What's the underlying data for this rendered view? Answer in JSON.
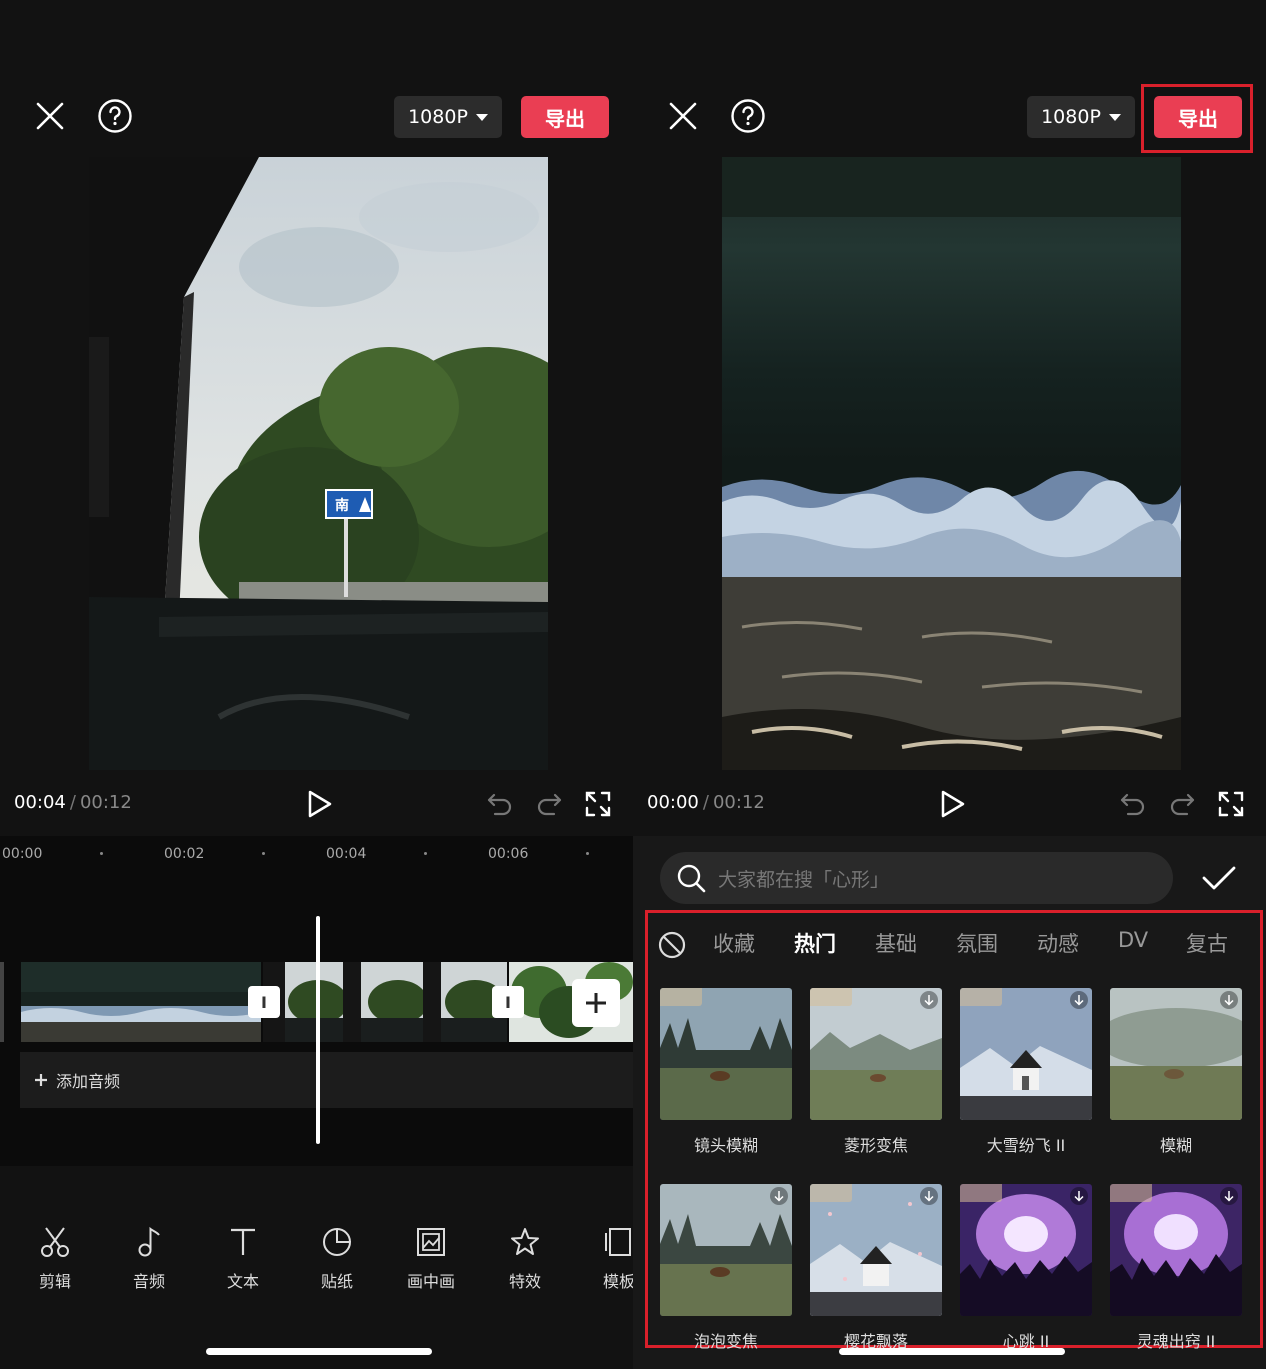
{
  "left": {
    "resolution": "1080P",
    "export_label": "导出",
    "time_current": "00:04",
    "time_sep": "/",
    "time_total": "00:12",
    "ruler": [
      "00:00",
      "00:02",
      "00:04",
      "00:06"
    ],
    "clip_separator": "I",
    "add_audio": "添加音频",
    "tools": [
      {
        "label": "剪辑",
        "icon": "scissors-icon"
      },
      {
        "label": "音频",
        "icon": "music-note-icon"
      },
      {
        "label": "文本",
        "icon": "text-icon"
      },
      {
        "label": "贴纸",
        "icon": "sticker-icon"
      },
      {
        "label": "画中画",
        "icon": "picture-in-picture-icon"
      },
      {
        "label": "特效",
        "icon": "effects-star-icon"
      },
      {
        "label": "模板",
        "icon": "template-icon"
      }
    ],
    "preview_sign": "南"
  },
  "right": {
    "resolution": "1080P",
    "export_label": "导出",
    "time_current": "00:00",
    "time_sep": "/",
    "time_total": "00:12",
    "search_placeholder": "大家都在搜「心形」",
    "categories": [
      "收藏",
      "热门",
      "基础",
      "氛围",
      "动感",
      "DV",
      "复古"
    ],
    "active_category": "热门",
    "effects": [
      {
        "name": "镜头模糊"
      },
      {
        "name": "菱形变焦"
      },
      {
        "name": "大雪纷飞 II"
      },
      {
        "name": "模糊"
      },
      {
        "name": "泡泡变焦"
      },
      {
        "name": "樱花飘落"
      },
      {
        "name": "心跳 II"
      },
      {
        "name": "灵魂出窍 II"
      }
    ]
  },
  "colors": {
    "export": "#ea3e53",
    "highlight": "#d9202b",
    "background": "#121212"
  }
}
